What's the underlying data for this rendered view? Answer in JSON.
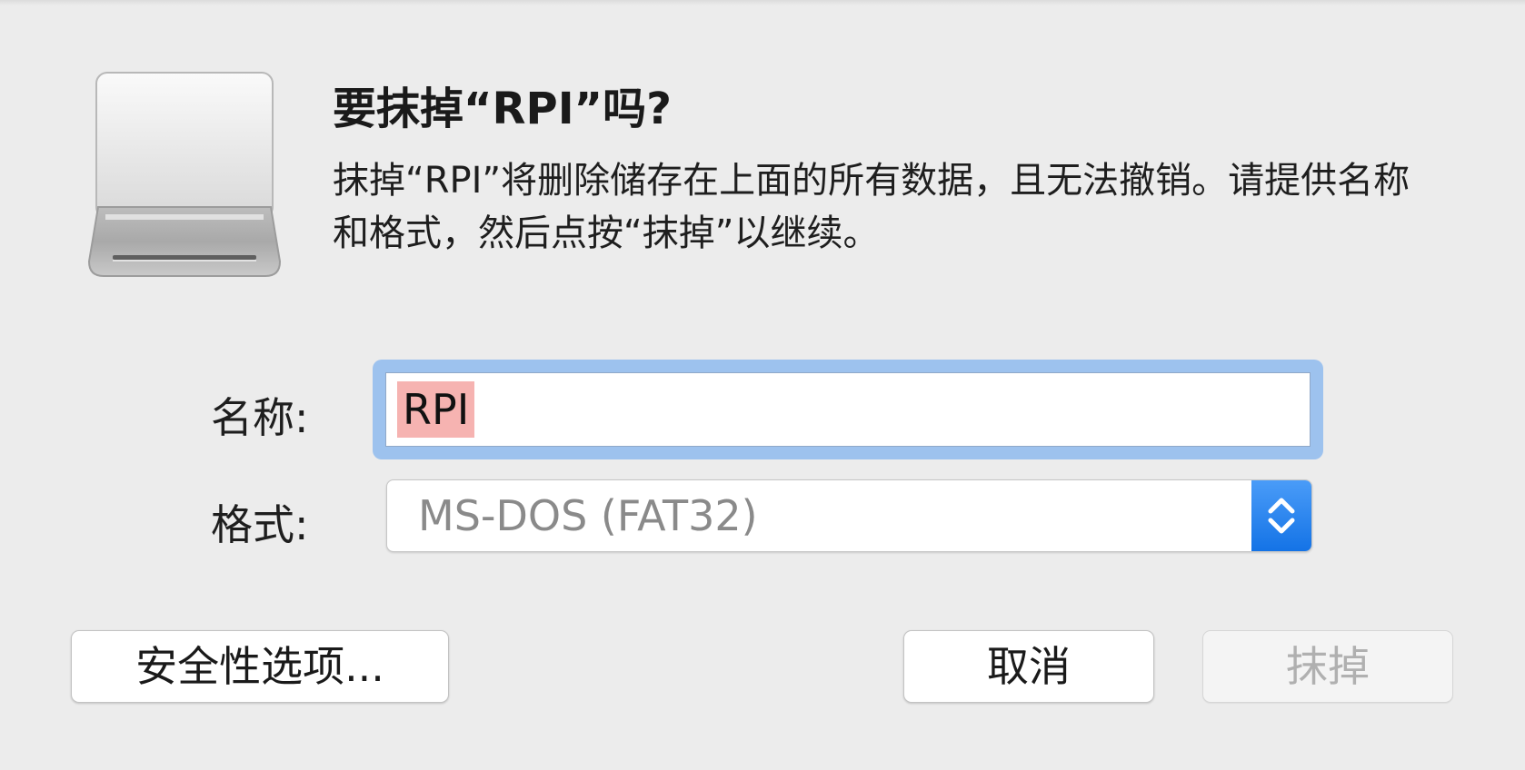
{
  "dialog": {
    "title": "要抹掉“RPI”吗?",
    "message": "抹掉“RPI”将删除储存在上面的所有数据，且无法撤销。请提供名称和格式，然后点按“抹掉”以继续。",
    "icon": "external-drive-icon"
  },
  "form": {
    "name_label": "名称:",
    "name_value": "RPI",
    "format_label": "格式:",
    "format_value": "MS-DOS (FAT32)",
    "format_stepper_icon": "chevron-up-down-icon"
  },
  "buttons": {
    "security_label": "安全性选项...",
    "cancel_label": "取消",
    "erase_label": "抹掉"
  },
  "colors": {
    "background": "#ececec",
    "focus_ring": "#9dc2ee",
    "selection": "#f6b3b1",
    "stepper_blue": "#1473e6",
    "disabled_text": "#b0b0b0"
  }
}
